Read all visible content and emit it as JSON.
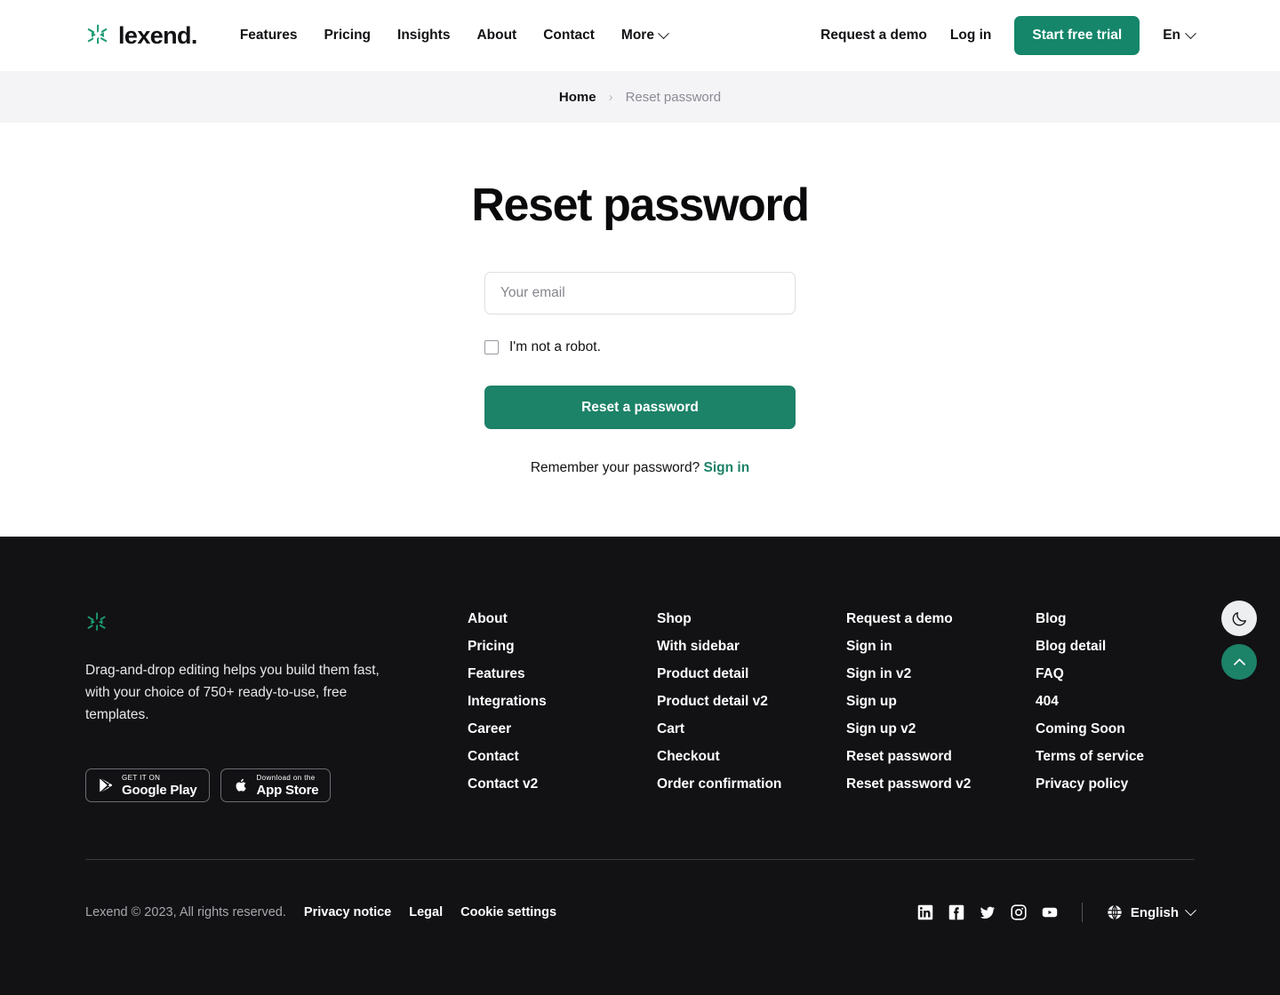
{
  "brand": {
    "name": "lexend.",
    "logo_icon": "lexend-asterisk-icon",
    "accent_color": "#1c8268"
  },
  "header": {
    "nav": [
      {
        "label": "Features",
        "icon": null
      },
      {
        "label": "Pricing",
        "icon": null
      },
      {
        "label": "Insights",
        "icon": null
      },
      {
        "label": "About",
        "icon": null
      },
      {
        "label": "Contact",
        "icon": null
      },
      {
        "label": "More",
        "icon": "chevron-down-icon"
      }
    ],
    "request_demo": "Request a demo",
    "log_in": "Log in",
    "start_trial": "Start free trial",
    "language": "En"
  },
  "breadcrumb": {
    "home": "Home",
    "separator": "›",
    "current": "Reset password"
  },
  "main": {
    "title": "Reset password",
    "email_placeholder": "Your email",
    "email_value": "",
    "robot_label": "I'm not a robot.",
    "robot_checked": false,
    "submit_label": "Reset a password",
    "remember_text": "Remember your password?",
    "sign_in_label": "Sign in"
  },
  "footer": {
    "tagline": "Drag-and-drop editing helps you build them fast, with your choice of 750+ ready-to-use, free templates.",
    "badges": [
      {
        "small": "GET IT ON",
        "big": "Google Play",
        "icon": "google-play-icon"
      },
      {
        "small": "Download on the",
        "big": "App Store",
        "icon": "apple-icon"
      }
    ],
    "columns": [
      {
        "links": [
          "About",
          "Pricing",
          "Features",
          "Integrations",
          "Career",
          "Contact",
          "Contact v2"
        ]
      },
      {
        "links": [
          "Shop",
          "With sidebar",
          "Product detail",
          "Product detail v2",
          "Cart",
          "Checkout",
          "Order confirmation"
        ]
      },
      {
        "links": [
          "Request a demo",
          "Sign in",
          "Sign in v2",
          "Sign up",
          "Sign up v2",
          "Reset password",
          "Reset password v2"
        ]
      },
      {
        "links": [
          "Blog",
          "Blog detail",
          "FAQ",
          "404",
          "Coming Soon",
          "Terms of service",
          "Privacy policy"
        ]
      }
    ],
    "copyright": "Lexend © 2023, All rights reserved.",
    "legal": [
      "Privacy notice",
      "Legal",
      "Cookie settings"
    ],
    "social": [
      "linkedin-icon",
      "facebook-icon",
      "twitter-icon",
      "instagram-icon",
      "youtube-icon"
    ],
    "language": "English"
  },
  "floating": {
    "dark_mode_icon": "moon-icon",
    "back_to_top_icon": "chevron-up-icon"
  }
}
